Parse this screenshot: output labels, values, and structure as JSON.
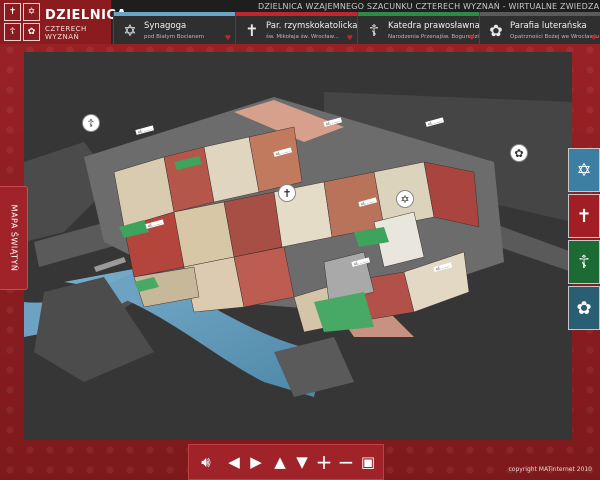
{
  "header": {
    "tagline": "DZIELNICA WZAJEMNEGO SZACUNKU CZTERECH WYZNAŃ - WIRTUALNE ZWIEDZANIE",
    "logo_title": "DZIELNICA",
    "logo_subtitle": "CZTERECH WYZNAŃ"
  },
  "tabs": [
    {
      "title": "Synagoga",
      "subtitle": "pod Białym Bocianem",
      "stripe": "#6aa6c8",
      "icon": "star-of-david-icon"
    },
    {
      "title": "Par. rzymskokatolicka",
      "subtitle": "św. Mikołaja św. Wrocław...",
      "stripe": "#c0262d",
      "icon": "latin-cross-icon"
    },
    {
      "title": "Katedra prawosławna",
      "subtitle": "Narodzenia Przenajśw. Bogurodzicy",
      "stripe": "#2e8b45",
      "icon": "orthodox-cross-icon"
    },
    {
      "title": "Parafia luterańska",
      "subtitle": "Opatrzności Bożej we Wrocławiu",
      "stripe": "#5a5a5a",
      "icon": "luther-rose-icon"
    }
  ],
  "side_tab": {
    "label": "MAPA ŚWIĄTYŃ"
  },
  "colors": {
    "jewish": "#3d7fa3",
    "catholic": "#a11e24",
    "orthodox": "#1d6b34",
    "lutheran": "#2a5f73"
  },
  "footer": {
    "copyright": "copyright MATinternet 2010"
  }
}
